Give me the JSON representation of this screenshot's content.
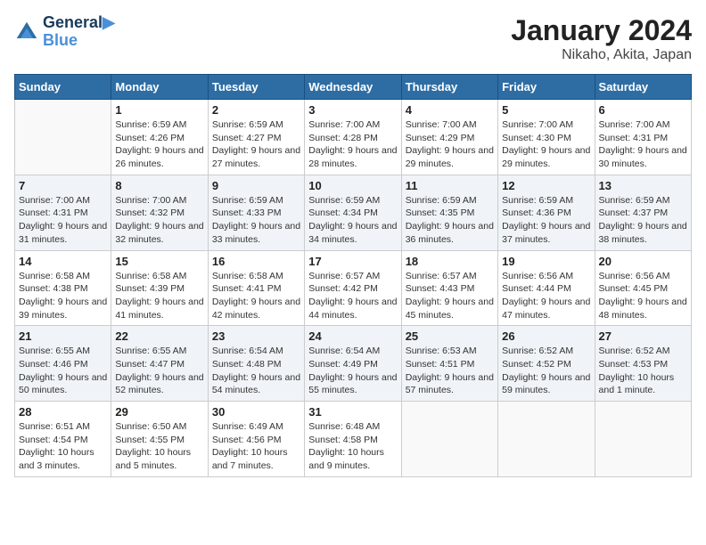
{
  "logo": {
    "line1": "General",
    "line2": "Blue"
  },
  "title": "January 2024",
  "subtitle": "Nikaho, Akita, Japan",
  "days_of_week": [
    "Sunday",
    "Monday",
    "Tuesday",
    "Wednesday",
    "Thursday",
    "Friday",
    "Saturday"
  ],
  "weeks": [
    [
      {
        "day": "",
        "sunrise": "",
        "sunset": "",
        "daylight": "",
        "empty": true
      },
      {
        "day": "1",
        "sunrise": "Sunrise: 6:59 AM",
        "sunset": "Sunset: 4:26 PM",
        "daylight": "Daylight: 9 hours and 26 minutes."
      },
      {
        "day": "2",
        "sunrise": "Sunrise: 6:59 AM",
        "sunset": "Sunset: 4:27 PM",
        "daylight": "Daylight: 9 hours and 27 minutes."
      },
      {
        "day": "3",
        "sunrise": "Sunrise: 7:00 AM",
        "sunset": "Sunset: 4:28 PM",
        "daylight": "Daylight: 9 hours and 28 minutes."
      },
      {
        "day": "4",
        "sunrise": "Sunrise: 7:00 AM",
        "sunset": "Sunset: 4:29 PM",
        "daylight": "Daylight: 9 hours and 29 minutes."
      },
      {
        "day": "5",
        "sunrise": "Sunrise: 7:00 AM",
        "sunset": "Sunset: 4:30 PM",
        "daylight": "Daylight: 9 hours and 29 minutes."
      },
      {
        "day": "6",
        "sunrise": "Sunrise: 7:00 AM",
        "sunset": "Sunset: 4:31 PM",
        "daylight": "Daylight: 9 hours and 30 minutes."
      }
    ],
    [
      {
        "day": "7",
        "sunrise": "Sunrise: 7:00 AM",
        "sunset": "Sunset: 4:31 PM",
        "daylight": "Daylight: 9 hours and 31 minutes."
      },
      {
        "day": "8",
        "sunrise": "Sunrise: 7:00 AM",
        "sunset": "Sunset: 4:32 PM",
        "daylight": "Daylight: 9 hours and 32 minutes."
      },
      {
        "day": "9",
        "sunrise": "Sunrise: 6:59 AM",
        "sunset": "Sunset: 4:33 PM",
        "daylight": "Daylight: 9 hours and 33 minutes."
      },
      {
        "day": "10",
        "sunrise": "Sunrise: 6:59 AM",
        "sunset": "Sunset: 4:34 PM",
        "daylight": "Daylight: 9 hours and 34 minutes."
      },
      {
        "day": "11",
        "sunrise": "Sunrise: 6:59 AM",
        "sunset": "Sunset: 4:35 PM",
        "daylight": "Daylight: 9 hours and 36 minutes."
      },
      {
        "day": "12",
        "sunrise": "Sunrise: 6:59 AM",
        "sunset": "Sunset: 4:36 PM",
        "daylight": "Daylight: 9 hours and 37 minutes."
      },
      {
        "day": "13",
        "sunrise": "Sunrise: 6:59 AM",
        "sunset": "Sunset: 4:37 PM",
        "daylight": "Daylight: 9 hours and 38 minutes."
      }
    ],
    [
      {
        "day": "14",
        "sunrise": "Sunrise: 6:58 AM",
        "sunset": "Sunset: 4:38 PM",
        "daylight": "Daylight: 9 hours and 39 minutes."
      },
      {
        "day": "15",
        "sunrise": "Sunrise: 6:58 AM",
        "sunset": "Sunset: 4:39 PM",
        "daylight": "Daylight: 9 hours and 41 minutes."
      },
      {
        "day": "16",
        "sunrise": "Sunrise: 6:58 AM",
        "sunset": "Sunset: 4:41 PM",
        "daylight": "Daylight: 9 hours and 42 minutes."
      },
      {
        "day": "17",
        "sunrise": "Sunrise: 6:57 AM",
        "sunset": "Sunset: 4:42 PM",
        "daylight": "Daylight: 9 hours and 44 minutes."
      },
      {
        "day": "18",
        "sunrise": "Sunrise: 6:57 AM",
        "sunset": "Sunset: 4:43 PM",
        "daylight": "Daylight: 9 hours and 45 minutes."
      },
      {
        "day": "19",
        "sunrise": "Sunrise: 6:56 AM",
        "sunset": "Sunset: 4:44 PM",
        "daylight": "Daylight: 9 hours and 47 minutes."
      },
      {
        "day": "20",
        "sunrise": "Sunrise: 6:56 AM",
        "sunset": "Sunset: 4:45 PM",
        "daylight": "Daylight: 9 hours and 48 minutes."
      }
    ],
    [
      {
        "day": "21",
        "sunrise": "Sunrise: 6:55 AM",
        "sunset": "Sunset: 4:46 PM",
        "daylight": "Daylight: 9 hours and 50 minutes."
      },
      {
        "day": "22",
        "sunrise": "Sunrise: 6:55 AM",
        "sunset": "Sunset: 4:47 PM",
        "daylight": "Daylight: 9 hours and 52 minutes."
      },
      {
        "day": "23",
        "sunrise": "Sunrise: 6:54 AM",
        "sunset": "Sunset: 4:48 PM",
        "daylight": "Daylight: 9 hours and 54 minutes."
      },
      {
        "day": "24",
        "sunrise": "Sunrise: 6:54 AM",
        "sunset": "Sunset: 4:49 PM",
        "daylight": "Daylight: 9 hours and 55 minutes."
      },
      {
        "day": "25",
        "sunrise": "Sunrise: 6:53 AM",
        "sunset": "Sunset: 4:51 PM",
        "daylight": "Daylight: 9 hours and 57 minutes."
      },
      {
        "day": "26",
        "sunrise": "Sunrise: 6:52 AM",
        "sunset": "Sunset: 4:52 PM",
        "daylight": "Daylight: 9 hours and 59 minutes."
      },
      {
        "day": "27",
        "sunrise": "Sunrise: 6:52 AM",
        "sunset": "Sunset: 4:53 PM",
        "daylight": "Daylight: 10 hours and 1 minute."
      }
    ],
    [
      {
        "day": "28",
        "sunrise": "Sunrise: 6:51 AM",
        "sunset": "Sunset: 4:54 PM",
        "daylight": "Daylight: 10 hours and 3 minutes."
      },
      {
        "day": "29",
        "sunrise": "Sunrise: 6:50 AM",
        "sunset": "Sunset: 4:55 PM",
        "daylight": "Daylight: 10 hours and 5 minutes."
      },
      {
        "day": "30",
        "sunrise": "Sunrise: 6:49 AM",
        "sunset": "Sunset: 4:56 PM",
        "daylight": "Daylight: 10 hours and 7 minutes."
      },
      {
        "day": "31",
        "sunrise": "Sunrise: 6:48 AM",
        "sunset": "Sunset: 4:58 PM",
        "daylight": "Daylight: 10 hours and 9 minutes."
      },
      {
        "day": "",
        "sunrise": "",
        "sunset": "",
        "daylight": "",
        "empty": true
      },
      {
        "day": "",
        "sunrise": "",
        "sunset": "",
        "daylight": "",
        "empty": true
      },
      {
        "day": "",
        "sunrise": "",
        "sunset": "",
        "daylight": "",
        "empty": true
      }
    ]
  ]
}
